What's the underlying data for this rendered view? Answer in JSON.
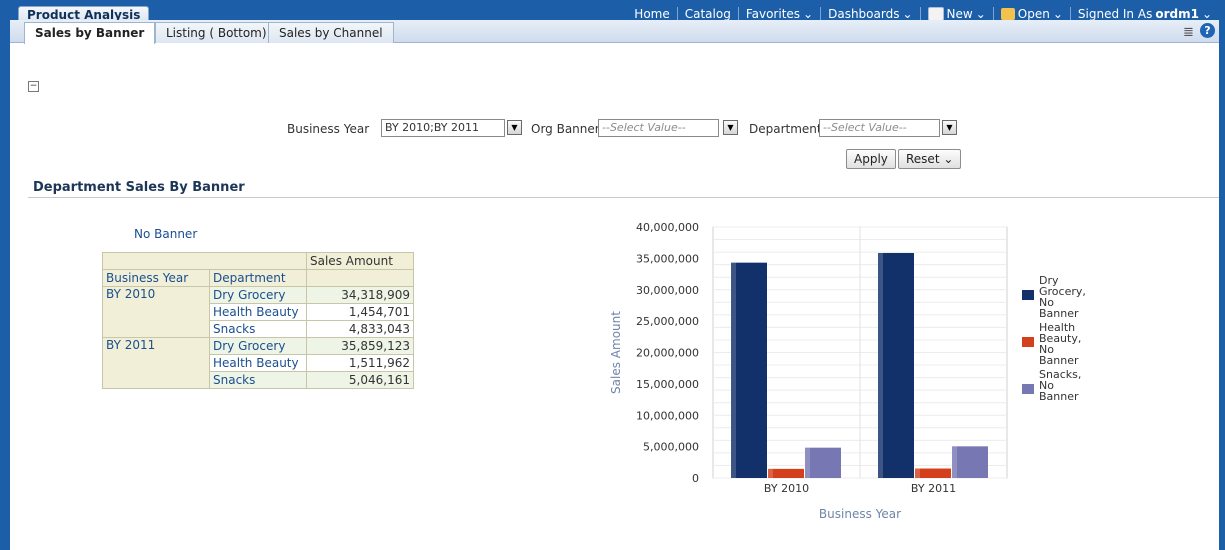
{
  "app": {
    "title": "Product Analysis"
  },
  "topnav": {
    "home": "Home",
    "catalog": "Catalog",
    "favorites": "Favorites",
    "dashboards": "Dashboards",
    "new": "New",
    "open": "Open",
    "signed_in_label": "Signed In As",
    "user": "ordm1"
  },
  "tabs": [
    {
      "label": "Sales by Banner"
    },
    {
      "label": "Listing ( Bottom)"
    },
    {
      "label": "Sales by Channel"
    }
  ],
  "prompts": {
    "business_year_label": "Business Year",
    "business_year_value": "BY 2010;BY 2011",
    "org_banner_label": "Org Banner",
    "org_banner_placeholder": "--Select Value--",
    "department_label": "Department",
    "department_placeholder": "--Select Value--",
    "apply": "Apply",
    "reset": "Reset"
  },
  "section": {
    "title": "Department Sales By Banner"
  },
  "pivot": {
    "banner": "No Banner",
    "measure_header": "Sales Amount",
    "col_business_year": "Business Year",
    "col_department": "Department",
    "groups": [
      {
        "year": "BY 2010",
        "rows": [
          {
            "dept": "Dry Grocery",
            "amount": "34,318,909"
          },
          {
            "dept": "Health Beauty",
            "amount": "1,454,701"
          },
          {
            "dept": "Snacks",
            "amount": "4,833,043"
          }
        ]
      },
      {
        "year": "BY 2011",
        "rows": [
          {
            "dept": "Dry Grocery",
            "amount": "35,859,123"
          },
          {
            "dept": "Health Beauty",
            "amount": "1,511,962"
          },
          {
            "dept": "Snacks",
            "amount": "5,046,161"
          }
        ]
      }
    ]
  },
  "chart_data": {
    "type": "bar",
    "categories": [
      "BY 2010",
      "BY 2011"
    ],
    "series": [
      {
        "name": "Dry Grocery, No Banner",
        "values": [
          34318909,
          35859123
        ],
        "color": "#12306a"
      },
      {
        "name": "Health Beauty, No Banner",
        "values": [
          1454701,
          1511962
        ],
        "color": "#d4401c"
      },
      {
        "name": "Snacks, No Banner",
        "values": [
          4833043,
          5046161
        ],
        "color": "#7777b3"
      }
    ],
    "title": "",
    "xlabel": "Business Year",
    "ylabel": "Sales Amount",
    "ylim": [
      0,
      40000000
    ],
    "yticks": [
      "0",
      "5,000,000",
      "10,000,000",
      "15,000,000",
      "20,000,000",
      "25,000,000",
      "30,000,000",
      "35,000,000",
      "40,000,000"
    ],
    "grid": true,
    "legend": "right"
  },
  "colors": {
    "brand_bar": "#1c5fa8",
    "link": "#1a4f8f"
  }
}
